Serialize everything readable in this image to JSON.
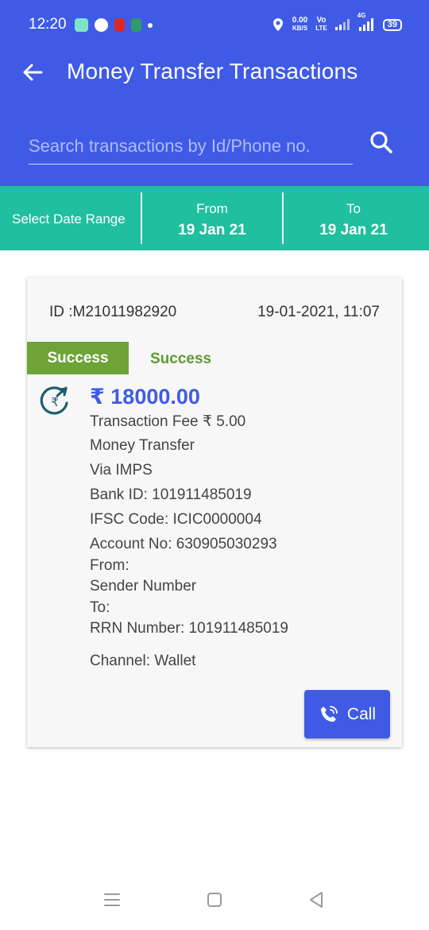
{
  "status_bar": {
    "time": "12:20",
    "net_speed_value": "0.00",
    "net_speed_unit": "KB/S",
    "volte_top": "Vo",
    "volte_bottom": "LTE",
    "network_type": "4G",
    "battery": "39"
  },
  "app_bar": {
    "title": "Money Transfer Transactions",
    "back_icon": "back-arrow-icon"
  },
  "search": {
    "placeholder": "Search transactions by Id/Phone no.",
    "value": "",
    "icon": "search-icon"
  },
  "date_range": {
    "label": "Select Date Range",
    "from_label": "From",
    "from_value": "19 Jan 21",
    "to_label": "To",
    "to_value": "19 Jan 21"
  },
  "transaction": {
    "id_text": "ID :M21011982920",
    "datetime": "19-01-2021, 11:07",
    "status_chip": "Success",
    "status_text": "Success",
    "amount": "₹ 18000.00",
    "fee": "Transaction Fee ₹ 5.00",
    "type": "Money Transfer",
    "via": "Via  IMPS",
    "bank_id": "Bank ID:  101911485019",
    "ifsc": "IFSC Code:  ICIC0000004",
    "account_no": "Account No:  630905030293",
    "from": "From:",
    "sender": "Sender Number",
    "to": "To:",
    "rrn": "RRN Number:  101911485019",
    "channel": "Channel:  Wallet",
    "call_label": "Call"
  },
  "colors": {
    "primary": "#3f5be6",
    "teal": "#1fbf9f",
    "success_green": "#6ea437",
    "card_bg": "#f7f7f7"
  }
}
